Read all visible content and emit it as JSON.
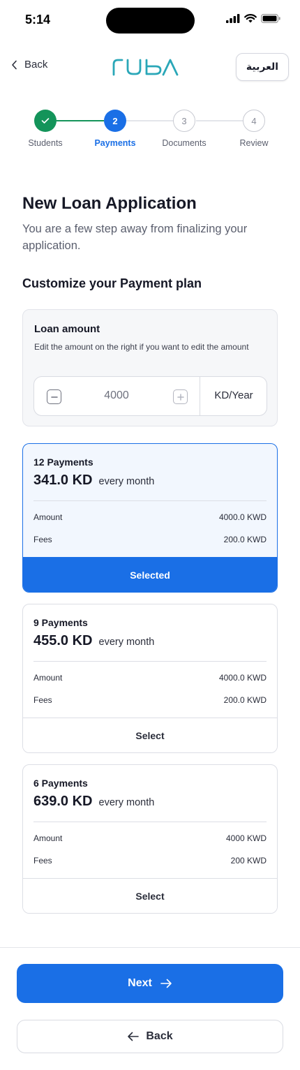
{
  "status_bar": {
    "time": "5:14"
  },
  "header": {
    "back_label": "Back",
    "brand": "ruba",
    "lang_label": "العربية"
  },
  "stepper": {
    "steps": [
      {
        "number": "",
        "label": "Students",
        "state": "done"
      },
      {
        "number": "2",
        "label": "Payments",
        "state": "active"
      },
      {
        "number": "3",
        "label": "Documents",
        "state": "todo"
      },
      {
        "number": "4",
        "label": "Review",
        "state": "todo"
      }
    ]
  },
  "page": {
    "title": "New Loan Application",
    "subtitle": "You are a few step away from finalizing your application.",
    "section_title": "Customize your Payment plan"
  },
  "loan": {
    "title": "Loan amount",
    "description": "Edit the amount on the right if you want to edit the amount",
    "value": "4000",
    "unit": "KD/Year"
  },
  "plans": [
    {
      "count": "12 Payments",
      "amount": "341.0 KD",
      "period": "every month",
      "amount_label": "Amount",
      "amount_value": "4000.0 KWD",
      "fees_label": "Fees",
      "fees_value": "200.0 KWD",
      "action": "Selected",
      "selected": true
    },
    {
      "count": "9 Payments",
      "amount": "455.0 KD",
      "period": "every month",
      "amount_label": "Amount",
      "amount_value": "4000.0 KWD",
      "fees_label": "Fees",
      "fees_value": "200.0 KWD",
      "action": "Select",
      "selected": false
    },
    {
      "count": "6 Payments",
      "amount": "639.0 KD",
      "period": "every month",
      "amount_label": "Amount",
      "amount_value": "4000 KWD",
      "fees_label": "Fees",
      "fees_value": "200 KWD",
      "action": "Select",
      "selected": false
    }
  ],
  "footer": {
    "next_label": "Next",
    "back_label": "Back"
  },
  "colors": {
    "primary": "#1a6fe6",
    "success": "#14945a",
    "brand": "#2aa7b8"
  }
}
